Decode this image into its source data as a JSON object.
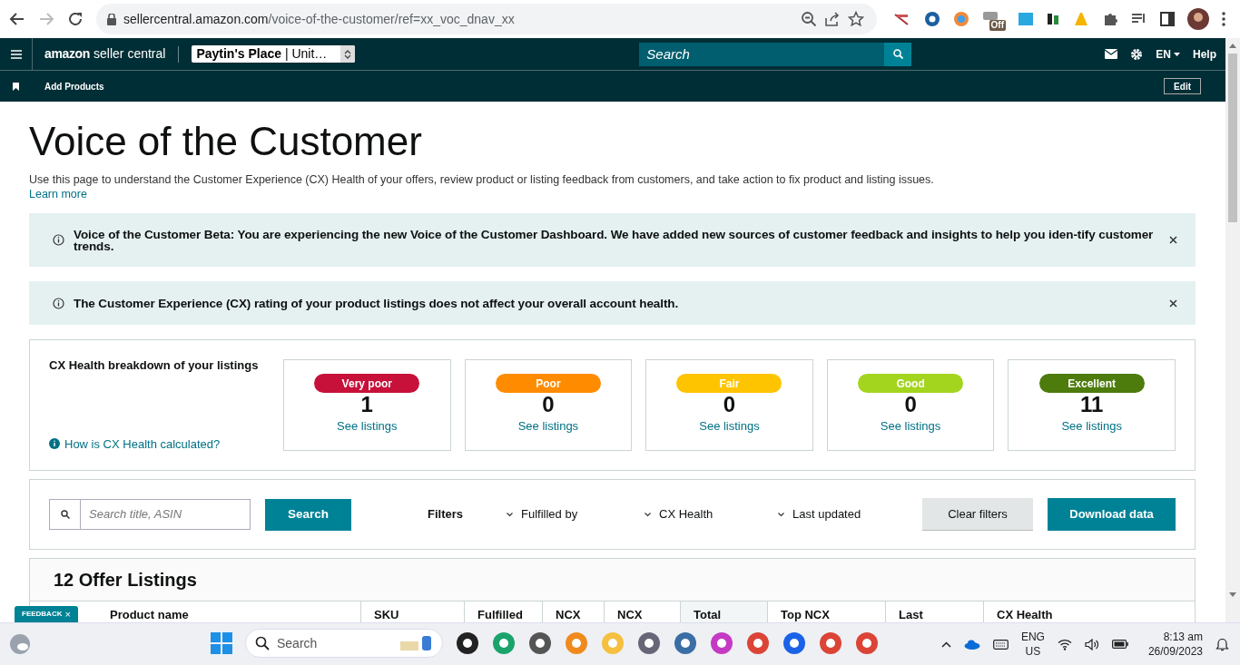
{
  "browser": {
    "url_host": "sellercentral.amazon.com",
    "url_path": "/voice-of-the-customer/ref=xx_voc_dnav_xx",
    "extension_badge": "Off"
  },
  "header": {
    "logo_word": "amazon",
    "logo_rest": "seller central",
    "store": "Paytin's Place",
    "store_region": "| Unit…",
    "search_placeholder": "Search",
    "language": "EN",
    "help": "Help"
  },
  "subnav": {
    "items": [
      "Add Products"
    ],
    "edit": "Edit"
  },
  "page": {
    "title": "Voice of the Customer",
    "description": "Use this page to understand the Customer Experience (CX) Health of your offers, review product or listing feedback from customers, and take action to fix product and listing issues.",
    "learn_more": "Learn more"
  },
  "banners": [
    {
      "text": "Voice of the Customer Beta: You are experiencing the new Voice of the Customer Dashboard. We have added new sources of customer feedback and insights to help you iden-tify customer trends."
    },
    {
      "text": "The Customer Experience (CX) rating of your product listings does not affect your overall account health."
    }
  ],
  "cx_health": {
    "title": "CX Health breakdown of your listings",
    "help_link": "How is CX Health calculated?",
    "cards": [
      {
        "label": "Very poor",
        "color": "#c7103a",
        "count": "1",
        "link": "See listings"
      },
      {
        "label": "Poor",
        "color": "#ff8c00",
        "count": "0",
        "link": "See listings"
      },
      {
        "label": "Fair",
        "color": "#ffc400",
        "count": "0",
        "link": "See listings"
      },
      {
        "label": "Good",
        "color": "#a4d51e",
        "count": "0",
        "link": "See listings"
      },
      {
        "label": "Excellent",
        "color": "#4d7b0c",
        "count": "11",
        "link": "See listings"
      }
    ]
  },
  "filters": {
    "search_placeholder": "Search title, ASIN",
    "search_button": "Search",
    "label": "Filters",
    "dropdowns": [
      "Fulfilled by",
      "CX Health",
      "Last updated"
    ],
    "clear": "Clear filters",
    "download": "Download data"
  },
  "listings": {
    "title": "12 Offer Listings",
    "columns": [
      {
        "label": "Product name",
        "highlighted": false
      },
      {
        "label": "SKU",
        "highlighted": false
      },
      {
        "label": "Fulfilled",
        "highlighted": false
      },
      {
        "label": "NCX",
        "highlighted": false
      },
      {
        "label": "NCX",
        "highlighted": false
      },
      {
        "label": "Total",
        "highlighted": true
      },
      {
        "label": "Top NCX",
        "highlighted": false
      },
      {
        "label": "Last",
        "highlighted": false
      },
      {
        "label": "CX Health",
        "highlighted": false
      }
    ]
  },
  "feedback_tab": {
    "label": "FEEDBACK",
    "close": "×"
  },
  "taskbar": {
    "search_placeholder": "Search",
    "language": "ENG",
    "region": "US",
    "time": "8:13 am",
    "date": "26/09/2023"
  }
}
